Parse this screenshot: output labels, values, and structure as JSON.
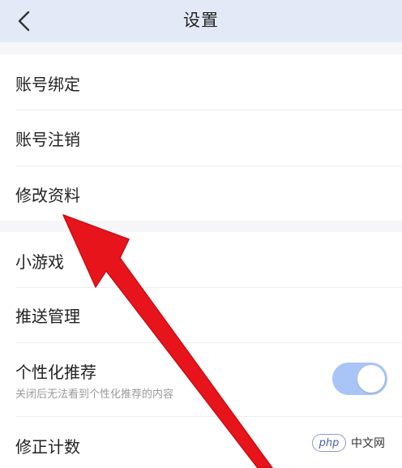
{
  "header": {
    "title": "设置",
    "back_icon": "chevron-left-icon"
  },
  "group1": {
    "items": [
      {
        "label": "账号绑定"
      },
      {
        "label": "账号注销"
      },
      {
        "label": "修改资料"
      }
    ]
  },
  "group2": {
    "items": [
      {
        "label": "小游戏"
      },
      {
        "label": "推送管理"
      },
      {
        "label": "个性化推荐",
        "subtitle": "关闭后无法看到个性化推荐的内容",
        "toggle_on": true
      },
      {
        "label": "修正计数"
      }
    ]
  },
  "watermark": {
    "logo": "php",
    "text": "中文网"
  },
  "colors": {
    "header_bg": "#e3e9f7",
    "toggle_on": "#a9c4f7",
    "arrow": "#e8141c"
  }
}
